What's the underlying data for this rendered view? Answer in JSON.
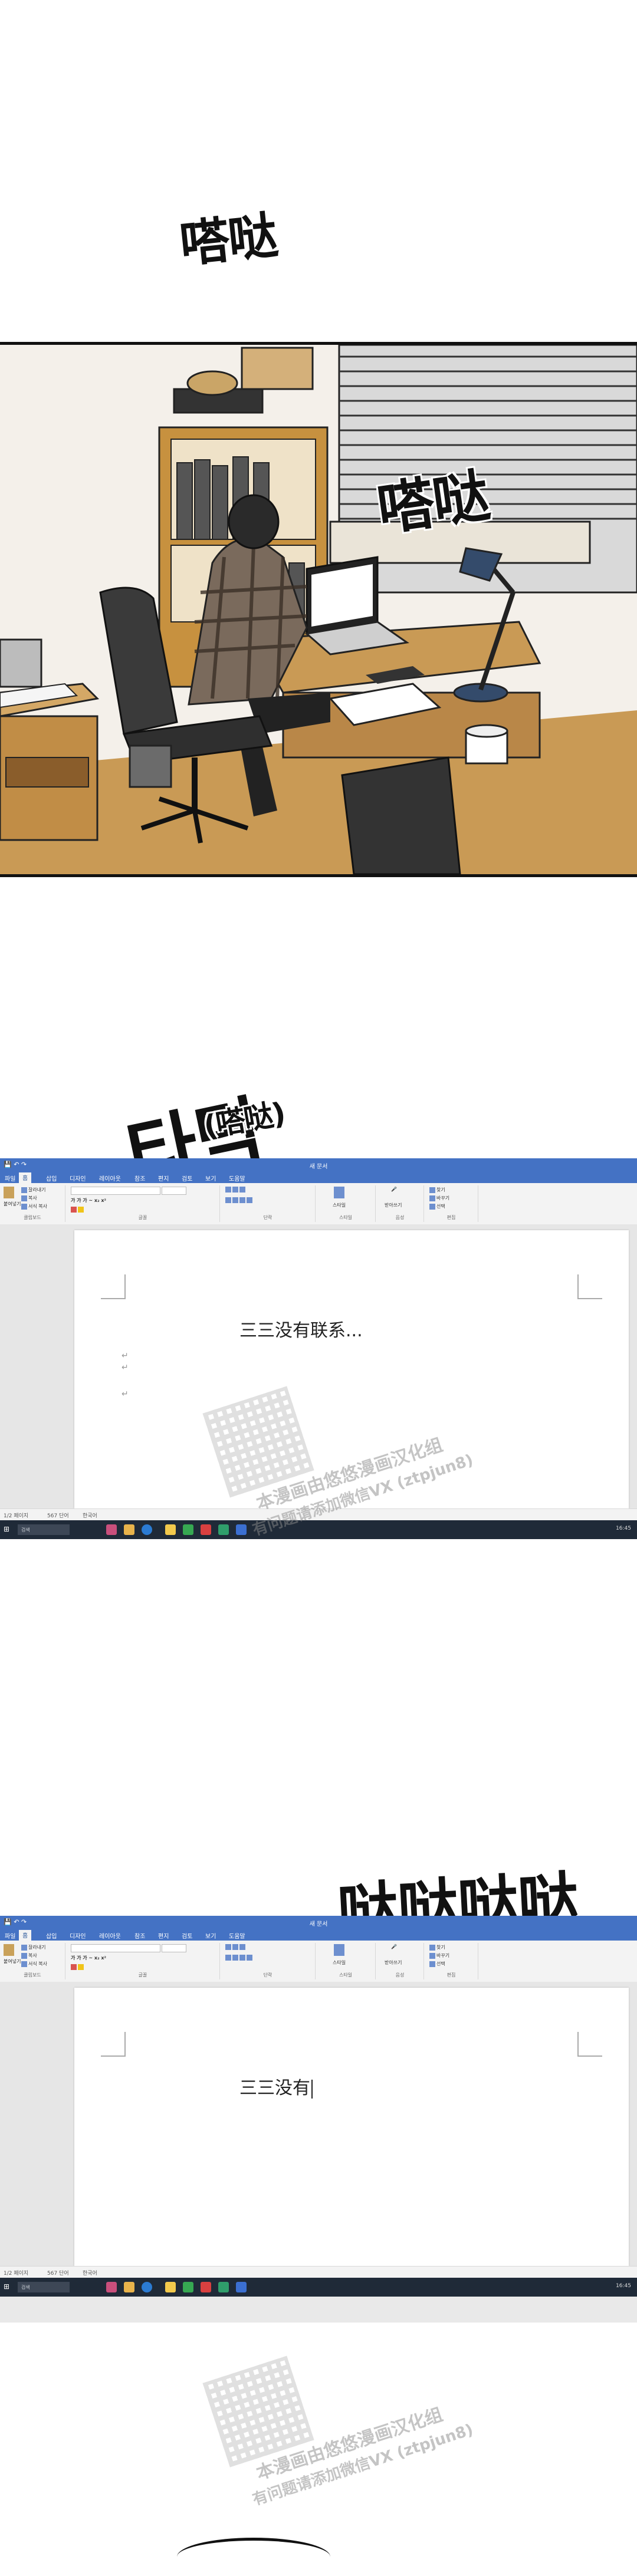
{
  "sfx": {
    "s1": "嗒哒",
    "s2": "嗒哒",
    "s3": "타닥",
    "s3_paren": "(嗒哒)",
    "s4": "哒哒哒哒哒哒"
  },
  "word": {
    "doc_title": "새 문서",
    "tabs": [
      "파일",
      "홈",
      "삽입",
      "디자인",
      "레이아웃",
      "참조",
      "편지",
      "검토",
      "보기",
      "도움말"
    ],
    "groups": [
      "클립보드",
      "글꼴",
      "단락",
      "스타일",
      "음성",
      "편집"
    ],
    "clipboard_items": [
      "잘라내기",
      "복사",
      "서식 복사"
    ],
    "paste_label": "붙여넣기",
    "edit_items": [
      "찾기",
      "바꾸기",
      "선택"
    ],
    "style_label": "스타일",
    "dictate_label": "받아쓰기",
    "status_page": "1/2 페이지",
    "status_words": "567 단어",
    "status_lang": "한국어",
    "search_placeholder": "검색",
    "clock": "16:45",
    "doc1_text": "三三没有联系...",
    "doc2_text": "三三没有"
  },
  "watermark": {
    "line1": "本漫画由悠悠漫画汉化组",
    "line2": "有问题请添加微信VX (ztpjun8)"
  },
  "colors": {
    "word_blue": "#4472c4",
    "taskbar": "#1f2a38"
  }
}
